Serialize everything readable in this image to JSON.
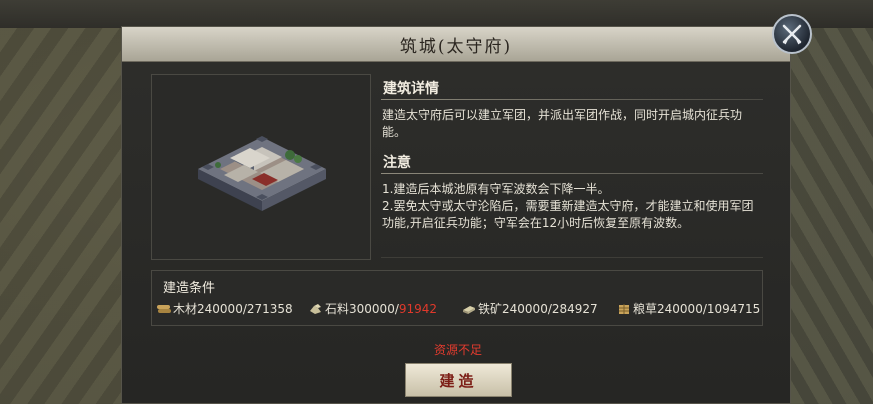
{
  "dialog": {
    "title": "筑城(太守府)"
  },
  "detail": {
    "heading": "建筑详情",
    "text": "建造太守府后可以建立军团，并派出军团作战，同时开启城内征兵功能。"
  },
  "notice": {
    "heading": "注意",
    "line1": "1.建造后本城池原有守军波数会下降一半。",
    "line2": "2.罢免太守或太守沦陷后，需要重新建造太守府，才能建立和使用军团功能,开启征兵功能；守军会在12小时后恢复至原有波数。"
  },
  "conditions": {
    "heading": "建造条件",
    "resources": [
      {
        "name": "木材",
        "required": "240000",
        "owned": "271358",
        "sufficient": true,
        "icon": "wood-icon"
      },
      {
        "name": "石料",
        "required": "300000",
        "owned": "91942",
        "sufficient": false,
        "icon": "stone-icon"
      },
      {
        "name": "铁矿",
        "required": "240000",
        "owned": "284927",
        "sufficient": true,
        "icon": "iron-icon"
      },
      {
        "name": "粮草",
        "required": "240000",
        "owned": "1094715",
        "sufficient": true,
        "icon": "grain-icon"
      }
    ]
  },
  "status": {
    "warning": "资源不足"
  },
  "actions": {
    "build_label": "建造",
    "close_icon": "close-icon"
  },
  "colors": {
    "insufficient": "#e0392b",
    "title_bar": "#c9c5b8",
    "panel": "#2b2b29"
  }
}
